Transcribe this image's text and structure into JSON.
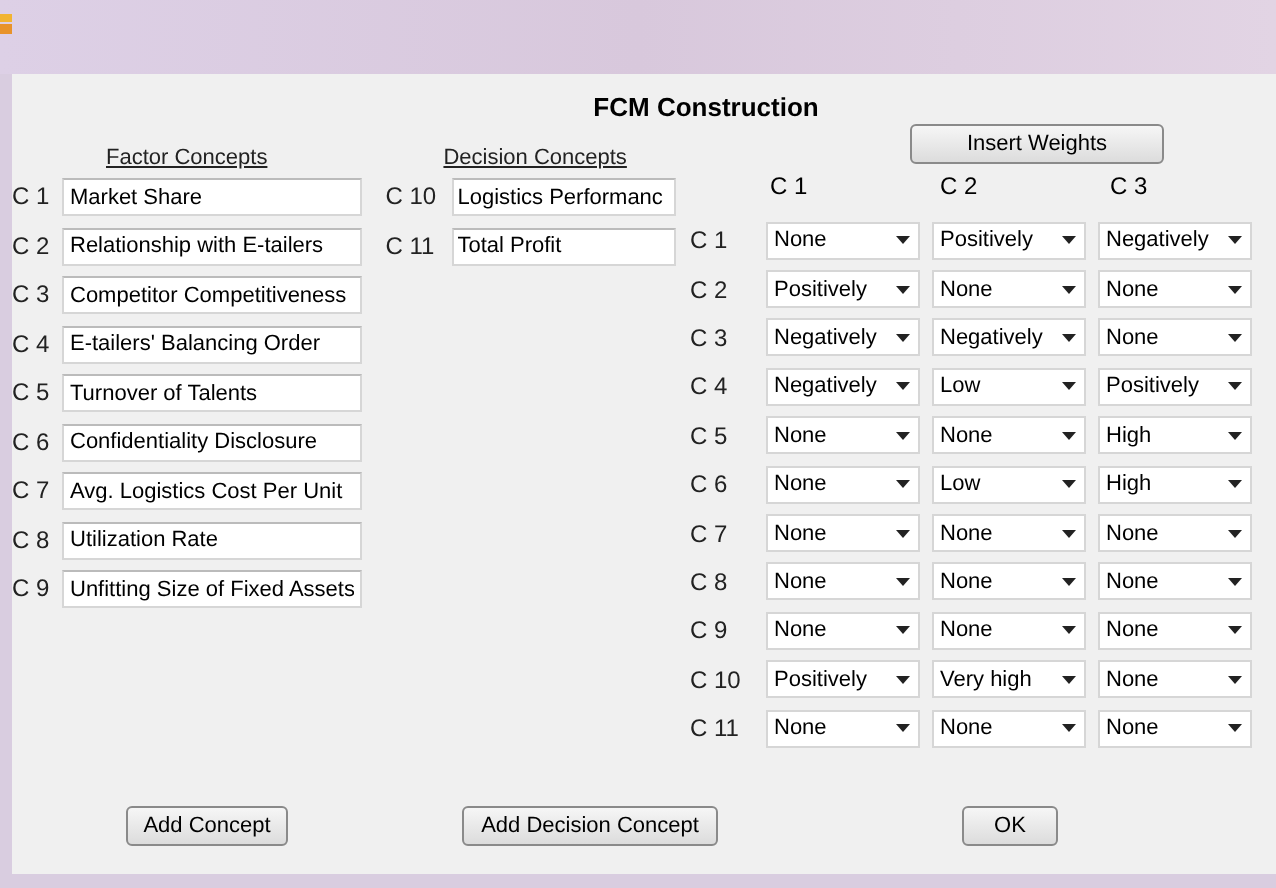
{
  "window": {
    "title": "FCM Construction"
  },
  "factor_concepts": {
    "heading": "Factor Concepts",
    "items": [
      {
        "label": "C 1",
        "value": "Market Share"
      },
      {
        "label": "C 2",
        "value": "Relationship with E-tailers"
      },
      {
        "label": "C 3",
        "value": "Competitor Competitiveness"
      },
      {
        "label": "C 4",
        "value": "E-tailers' Balancing Order"
      },
      {
        "label": "C 5",
        "value": "Turnover of Talents"
      },
      {
        "label": "C 6",
        "value": "Confidentiality Disclosure"
      },
      {
        "label": "C 7",
        "value": "Avg. Logistics Cost Per Unit"
      },
      {
        "label": "C 8",
        "value": "Utilization Rate"
      },
      {
        "label": "C 9",
        "value": "Unfitting Size of Fixed Assets"
      }
    ]
  },
  "decision_concepts": {
    "heading": "Decision Concepts",
    "items": [
      {
        "label": "C 10",
        "value": "Logistics Performanc"
      },
      {
        "label": "C 11",
        "value": "Total Profit"
      }
    ]
  },
  "weights": {
    "button": "Insert Weights",
    "columns": [
      "C 1",
      "C 2",
      "C 3"
    ],
    "rows": [
      {
        "label": "C 1",
        "values": [
          "None",
          "Positively",
          "Negatively"
        ]
      },
      {
        "label": "C 2",
        "values": [
          "Positively",
          "None",
          "None"
        ]
      },
      {
        "label": "C 3",
        "values": [
          "Negatively",
          "Negatively",
          "None"
        ]
      },
      {
        "label": "C 4",
        "values": [
          "Negatively",
          "Low",
          "Positively"
        ]
      },
      {
        "label": "C 5",
        "values": [
          "None",
          "None",
          "High"
        ]
      },
      {
        "label": "C 6",
        "values": [
          "None",
          "Low",
          "High"
        ]
      },
      {
        "label": "C 7",
        "values": [
          "None",
          "None",
          "None"
        ]
      },
      {
        "label": "C 8",
        "values": [
          "None",
          "None",
          "None"
        ]
      },
      {
        "label": "C 9",
        "values": [
          "None",
          "None",
          "None"
        ]
      },
      {
        "label": "C 10",
        "values": [
          "Positively",
          "Very high",
          "None"
        ]
      },
      {
        "label": "C 11",
        "values": [
          "None",
          "None",
          "None"
        ]
      }
    ]
  },
  "buttons": [
    "Add Concept",
    "Add Decision Concept",
    "OK"
  ]
}
